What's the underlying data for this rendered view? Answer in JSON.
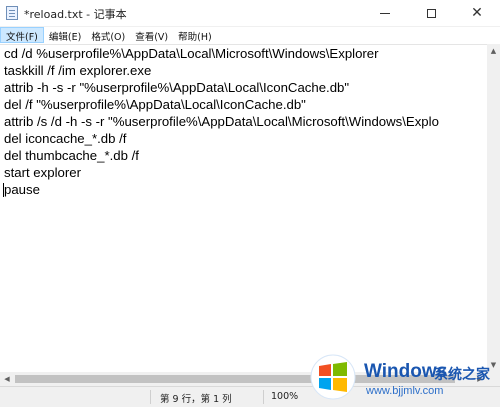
{
  "window": {
    "title": "*reload.txt - 记事本",
    "minimize_icon": "minimize-icon",
    "maximize_icon": "maximize-icon",
    "close_glyph": "✕"
  },
  "menu": {
    "items": [
      {
        "label": "文件(F)"
      },
      {
        "label": "编辑(E)"
      },
      {
        "label": "格式(O)"
      },
      {
        "label": "查看(V)"
      },
      {
        "label": "帮助(H)"
      }
    ],
    "active_color": "#cce8ff"
  },
  "editor": {
    "lines": [
      "cd /d %userprofile%\\AppData\\Local\\Microsoft\\Windows\\Explorer",
      "taskkill /f /im explorer.exe",
      "attrib -h -s -r \"%userprofile%\\AppData\\Local\\IconCache.db\"",
      "del /f \"%userprofile%\\AppData\\Local\\IconCache.db\"",
      "attrib /s /d -h -s -r \"%userprofile%\\AppData\\Local\\Microsoft\\Windows\\Explo",
      "del iconcache_*.db /f",
      "del thumbcache_*.db /f",
      "start explorer",
      "pause"
    ]
  },
  "scrollbars": {
    "up_arrow": "▲",
    "down_arrow": "▼",
    "left_arrow": "◀",
    "right_arrow": "▶"
  },
  "status": {
    "position": "第 9 行，第 1 列",
    "zoom": "100%"
  },
  "watermark": {
    "brand": "Windows",
    "brand_cn": "系统之家",
    "url": "www.bjjmlv.com",
    "colors": [
      "#f25022",
      "#7fba00",
      "#00a4ef",
      "#ffb900"
    ]
  }
}
